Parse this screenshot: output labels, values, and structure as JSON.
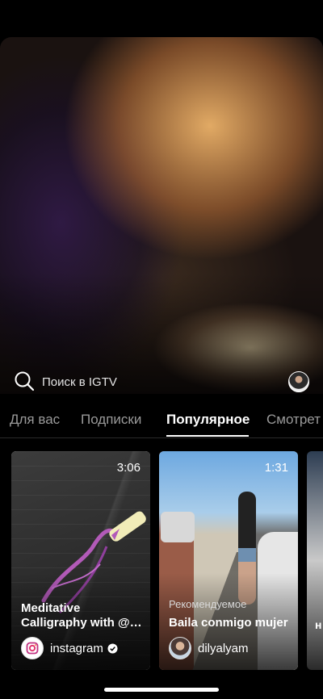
{
  "search": {
    "placeholder": "Поиск в IGTV"
  },
  "tabs": [
    {
      "label": "Для вас",
      "active": false
    },
    {
      "label": "Подписки",
      "active": false
    },
    {
      "label": "Популярное",
      "active": true
    },
    {
      "label": "Смотрет",
      "active": false
    }
  ],
  "cards": [
    {
      "duration": "3:06",
      "label": "",
      "title": "Meditative Calligraphy with @…",
      "account": "instagram",
      "verified": true
    },
    {
      "duration": "1:31",
      "label": "Рекомендуемое",
      "title": "Baila conmigo mujer",
      "account": "dilyalyam",
      "verified": false
    },
    {
      "peek_text": "н"
    }
  ],
  "colors": {
    "background": "#000000",
    "tab_inactive": "#9a9a9a",
    "tab_active": "#ffffff"
  },
  "icons": {
    "search": "search-icon",
    "verified": "verified-badge-icon",
    "instagram": "instagram-logo-icon"
  }
}
